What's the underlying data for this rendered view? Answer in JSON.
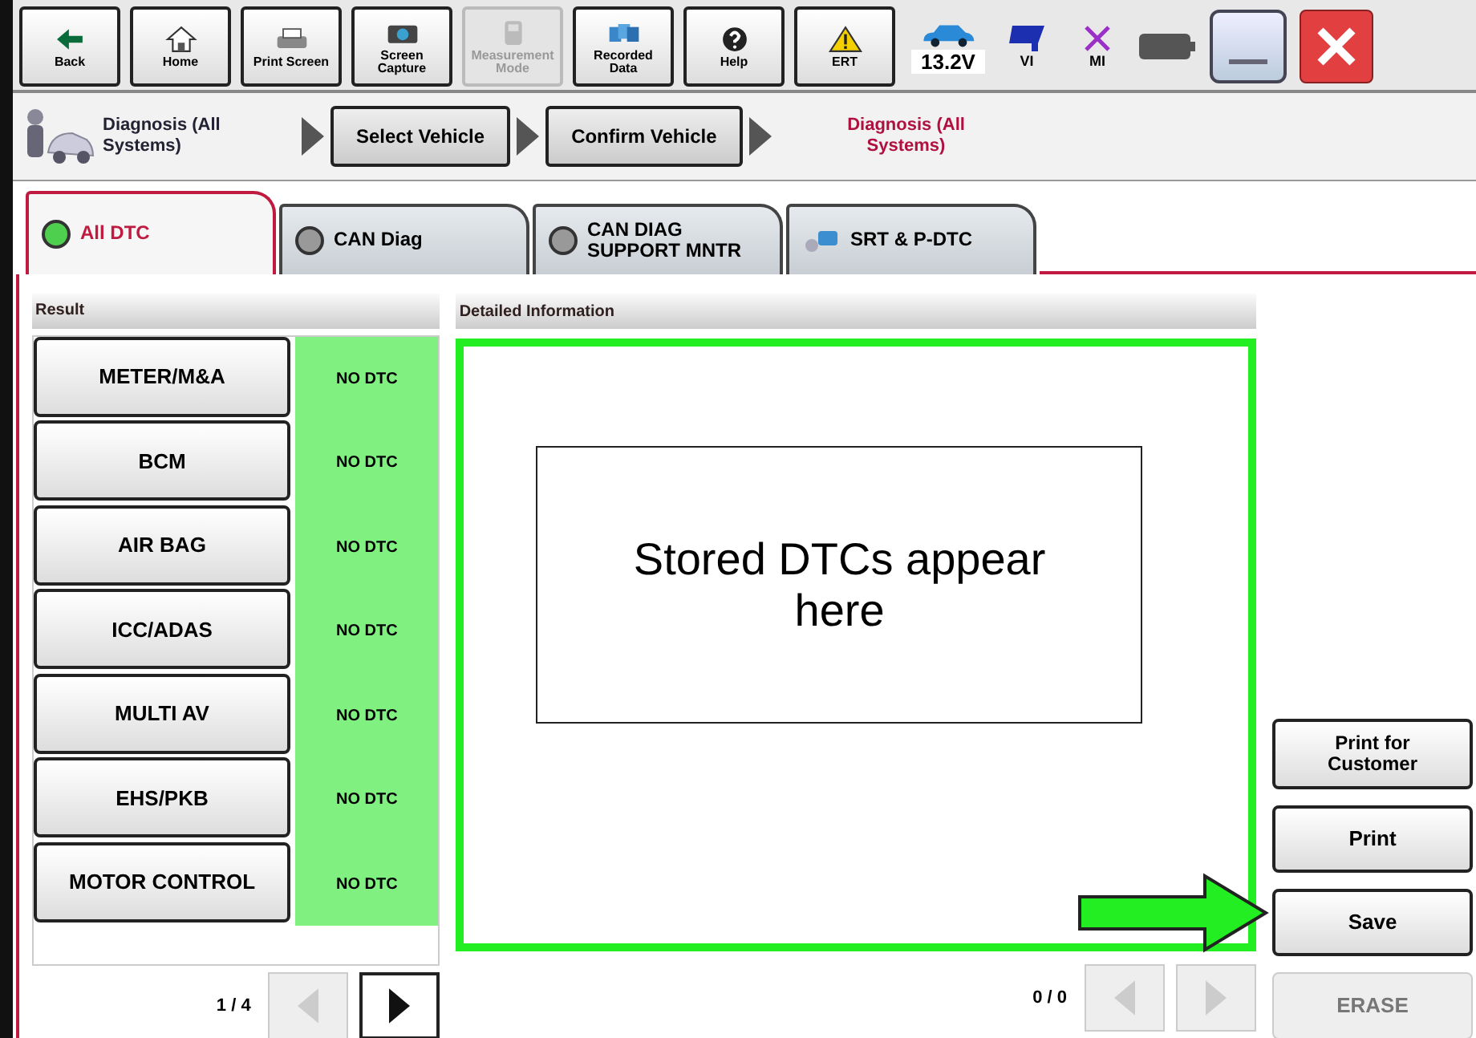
{
  "toolbar": {
    "buttons": [
      {
        "label": "Back",
        "kind": "back",
        "disabled": false
      },
      {
        "label": "Home",
        "kind": "home",
        "disabled": false
      },
      {
        "label": "Print Screen",
        "kind": "print",
        "disabled": false
      },
      {
        "label": "Screen Capture",
        "kind": "camera",
        "disabled": false
      },
      {
        "label": "Measurement Mode",
        "kind": "meter",
        "disabled": true
      },
      {
        "label": "Recorded Data",
        "kind": "data",
        "disabled": false
      },
      {
        "label": "Help",
        "kind": "help",
        "disabled": false
      },
      {
        "label": "ERT",
        "kind": "warning",
        "disabled": false
      }
    ],
    "voltage": "13.2V",
    "vi": "VI",
    "mi": "MI"
  },
  "breadcrumb": {
    "title": "Diagnosis (All Systems)",
    "steps": [
      "Select Vehicle",
      "Confirm Vehicle"
    ],
    "current": "Diagnosis (All Systems)"
  },
  "tabs": [
    {
      "label": "All DTC",
      "kind": "lamp",
      "selected": true
    },
    {
      "label": "CAN Diag",
      "kind": "lamp",
      "selected": false
    },
    {
      "label": "CAN DIAG SUPPORT MNTR",
      "kind": "lamp",
      "selected": false
    },
    {
      "label": "SRT & P-DTC",
      "kind": "tool",
      "selected": false
    }
  ],
  "result": {
    "header": "Result",
    "rows": [
      {
        "name": "METER/M&A",
        "status": "NO DTC"
      },
      {
        "name": "BCM",
        "status": "NO DTC"
      },
      {
        "name": "AIR BAG",
        "status": "NO DTC"
      },
      {
        "name": "ICC/ADAS",
        "status": "NO DTC"
      },
      {
        "name": "MULTI AV",
        "status": "NO DTC"
      },
      {
        "name": "EHS/PKB",
        "status": "NO DTC"
      },
      {
        "name": "MOTOR CONTROL",
        "status": "NO DTC"
      }
    ],
    "page": "1 / 4",
    "prev_disabled": true,
    "next_disabled": false
  },
  "detail": {
    "header": "Detailed Information",
    "note": "Stored DTCs appear here",
    "page": "0 / 0",
    "prev_disabled": true,
    "next_disabled": true
  },
  "actions": [
    {
      "label": "Print for Customer",
      "disabled": false,
      "pointed": false
    },
    {
      "label": "Print",
      "disabled": false,
      "pointed": false
    },
    {
      "label": "Save",
      "disabled": false,
      "pointed": true
    },
    {
      "label": "ERASE",
      "disabled": true,
      "pointed": false
    }
  ]
}
